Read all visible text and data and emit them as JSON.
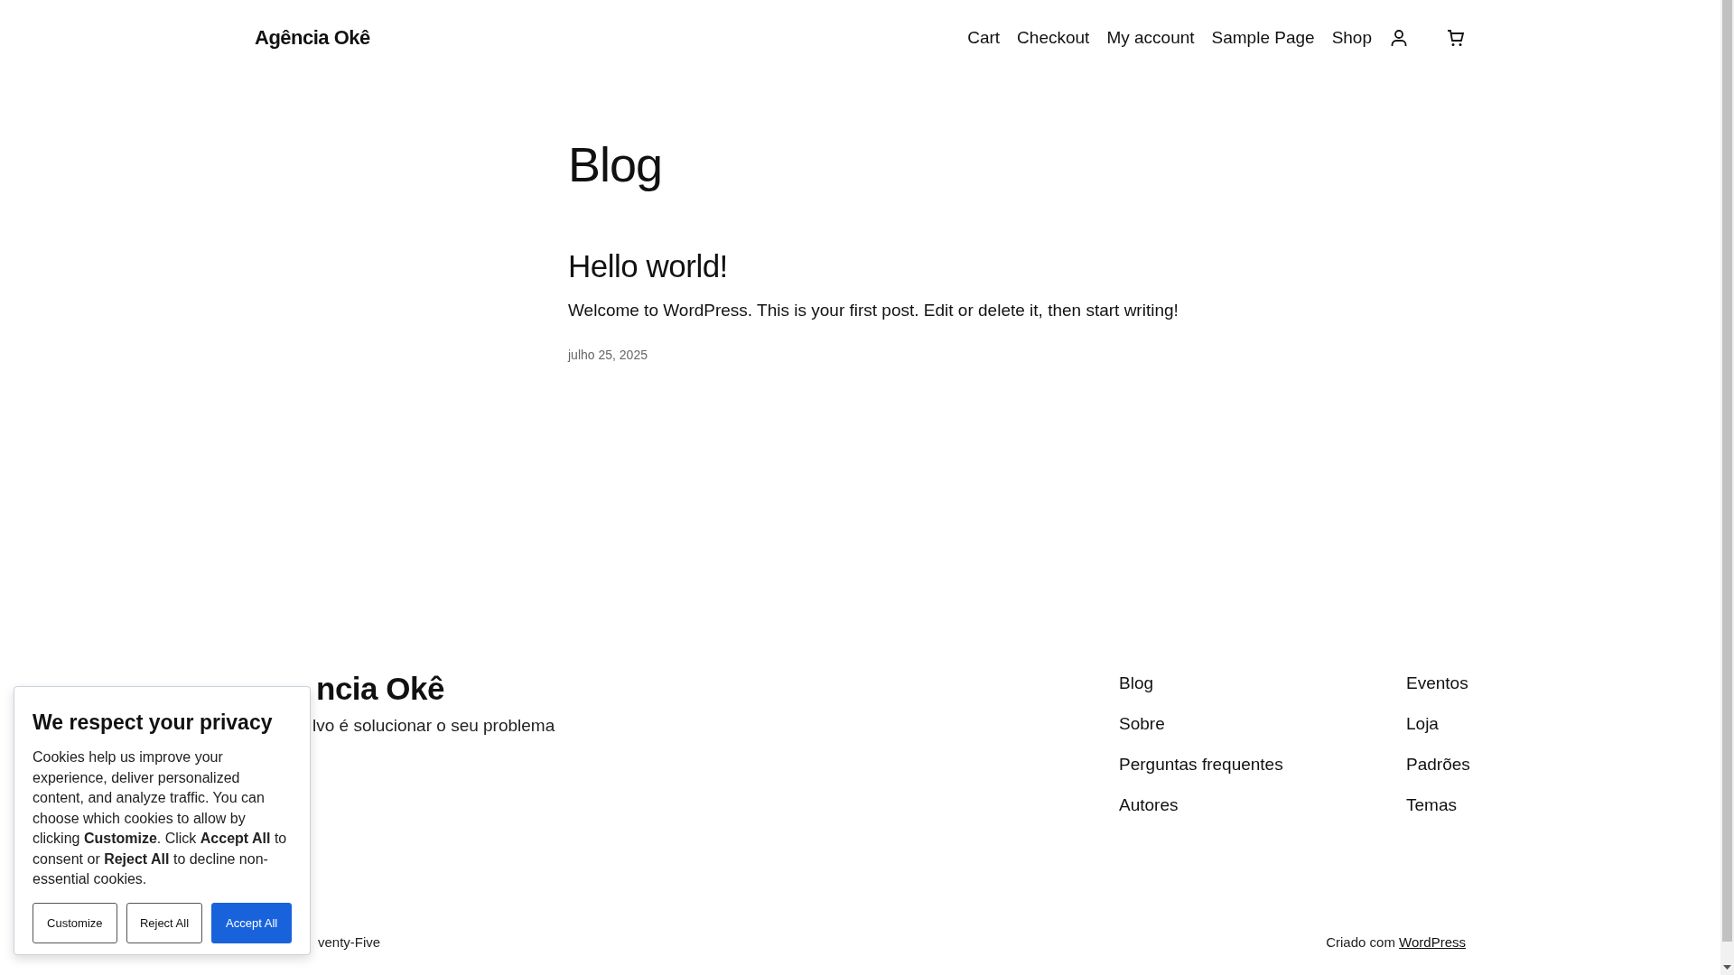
{
  "header": {
    "site_title": "Agência Okê",
    "nav": [
      "Cart",
      "Checkout",
      "My account",
      "Sample Page",
      "Shop"
    ]
  },
  "page_title": "Blog",
  "posts": [
    {
      "title": "Hello world!",
      "excerpt": "Welcome to WordPress. This is your first post. Edit or delete it, then start writing!",
      "date": "julho 25, 2025"
    }
  ],
  "footer": {
    "site_title": "ncia Okê",
    "tagline": "lvo é solucionar o seu problema",
    "columns": [
      [
        "Blog",
        "Sobre",
        "Perguntas frequentes",
        "Autores"
      ],
      [
        "Eventos",
        "Loja",
        "Padrões",
        "Temas"
      ]
    ],
    "credit_left": "venty-Five",
    "credit_prefix": "Criado com",
    "credit_link": "WordPress"
  },
  "cookie_banner": {
    "title": "We respect your privacy",
    "text": "Cookies help us improve your experience, deliver personalized content, and analyze traffic. You can choose which cookies to allow by clicking **Customize**. Click **Accept All** to consent or **Reject All** to decline non-essential cookies.",
    "buttons": [
      {
        "label": "Customize",
        "kind": "outline"
      },
      {
        "label": "Reject All",
        "kind": "outline"
      },
      {
        "label": "Accept All",
        "kind": "primary"
      }
    ]
  }
}
